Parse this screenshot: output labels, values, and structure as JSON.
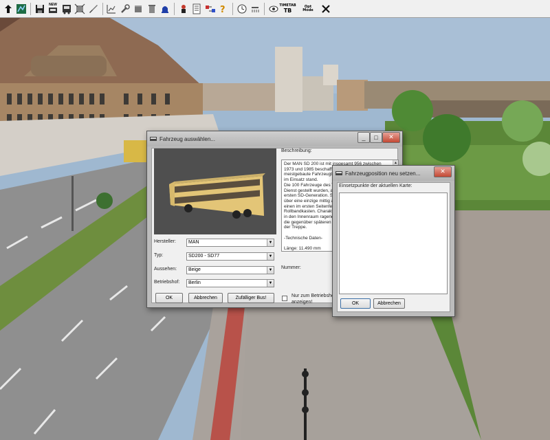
{
  "toolbar": {
    "items": [
      {
        "icon": "arrow-up-icon"
      },
      {
        "icon": "map-icon"
      },
      {
        "icon": "save-icon"
      },
      {
        "icon": "new-vehicle-icon",
        "text": "NEW"
      },
      {
        "icon": "bus-front-icon"
      },
      {
        "icon": "select-frame-icon"
      },
      {
        "icon": "brush-icon"
      },
      {
        "icon": "stats-icon"
      },
      {
        "icon": "wrench-icon"
      },
      {
        "icon": "cylinder-icon"
      },
      {
        "icon": "trash-icon"
      },
      {
        "icon": "bell-icon"
      },
      {
        "icon": "fire-person-icon"
      },
      {
        "icon": "document-icon"
      },
      {
        "icon": "swap-icon"
      },
      {
        "icon": "question-icon"
      },
      {
        "icon": "clock-icon"
      },
      {
        "icon": "weather-icon"
      },
      {
        "icon": "eye-icon"
      },
      {
        "icon": "timetable-icon",
        "text": "TIMETAB"
      },
      {
        "icon": "options-icon",
        "text": "Opt Mode"
      },
      {
        "icon": "close-x-icon"
      }
    ],
    "badge_new": "NEW",
    "badge_timetab_1": "TIMETAB",
    "badge_opt_1": "Opt",
    "badge_opt_2": "Mode"
  },
  "vehicle_dialog": {
    "title": "Fahrzeug auswählen...",
    "description_label": "Beschreibung:",
    "description_text": "Der MAN SD 200 ist mit insgesamt 956 zwischen\n1973 und 1985 beschafften Fahrzeugen der\nmeistgebaute Fahrzeugtyp ...\nim Einsatz stand.\nDie 100 Fahrzeuge des T...\nDienst gestellt wurden, a...\nersten SD-Generation. S...\nüber eine einzige mittig a...\neinen im ersten Seitenfe...\nRollbandkasten. Charakt...\nin den Innenraum ragend...\ndie gegenüber späteren ...\nder Treppe.\n\n-Technische Daten-\n\nLänge: 11.490 mm",
    "number_label": "Nummer:",
    "manufacturer_label": "Hersteller:",
    "manufacturer_value": "MAN",
    "type_label": "Typ:",
    "type_value": "SD200 - SD77",
    "appearance_label": "Aussehen:",
    "appearance_value": "Beige",
    "depot_label": "Betriebshof:",
    "depot_value": "Berlin",
    "ok_label": "OK",
    "cancel_label": "Abbrechen",
    "random_label": "Zufälliger Bus!",
    "checkbox_label_1": "Nur zum Betriebshof",
    "checkbox_label_2": "anzeigen!",
    "checkbox_checked": false
  },
  "position_dialog": {
    "title": "Fahrzeugposition neu setzen...",
    "entry_label": "Einsetzpunkte der aktuellen Karte:",
    "ok_label": "OK",
    "cancel_label": "Abbrechen"
  },
  "colors": {
    "bus_body": "#e4c878",
    "preview_bg": "#505050",
    "grass": "#5e8a3c",
    "road": "#8a8a8a"
  }
}
